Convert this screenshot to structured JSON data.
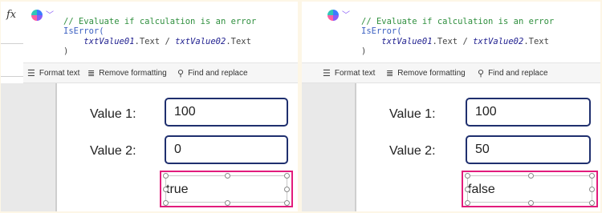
{
  "formula_bar": {
    "fx_label": "fx",
    "code_lines": [
      "// Evaluate if calculation is an error",
      "IsError(",
      "txtValue01",
      ".Text / ",
      "txtValue02",
      ".Text",
      ")"
    ]
  },
  "toolbar": {
    "format_text": "Format text",
    "remove_formatting": "Remove formatting",
    "find_replace": "Find and replace"
  },
  "left": {
    "value1_label": "Value 1:",
    "value1": "100",
    "value2_label": "Value 2:",
    "value2": "0",
    "result": "true"
  },
  "right": {
    "value1_label": "Value 1:",
    "value1": "100",
    "value2_label": "Value 2:",
    "value2": "50",
    "result": "false"
  },
  "colors": {
    "input_border": "#1f2f6e",
    "selection_border": "#e21c7c",
    "comment": "#2f8f3e",
    "function": "#3a5fc1"
  }
}
